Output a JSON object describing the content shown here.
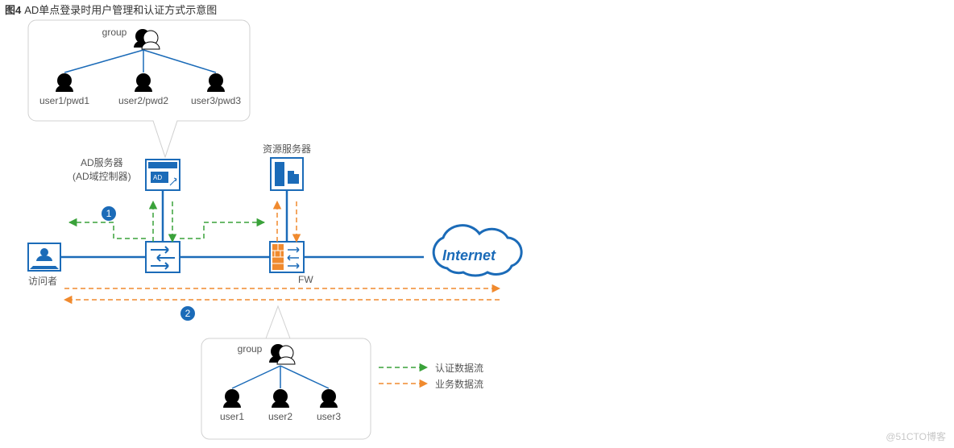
{
  "title_prefix": "图4",
  "title_text": "AD单点登录时用户管理和认证方式示意图",
  "watermark": "@51CTO博客",
  "top_group": {
    "group_label": "group",
    "users": [
      "user1/pwd1",
      "user2/pwd2",
      "user3/pwd3"
    ]
  },
  "bottom_group": {
    "group_label": "group",
    "users": [
      "user1",
      "user2",
      "user3"
    ]
  },
  "nodes": {
    "ad_server": "AD服务器\n(AD域控制器)",
    "resource_server": "资源服务器",
    "visitor": "访问者",
    "fw": "FW",
    "internet": "Internet"
  },
  "legend": {
    "auth_flow": "认证数据流",
    "biz_flow": "业务数据流"
  },
  "steps": [
    "1",
    "2"
  ],
  "colors": {
    "blue": "#1b6bb8",
    "orange": "#f08a2e",
    "green": "#3aa23a",
    "grey": "#d0d0d0"
  }
}
